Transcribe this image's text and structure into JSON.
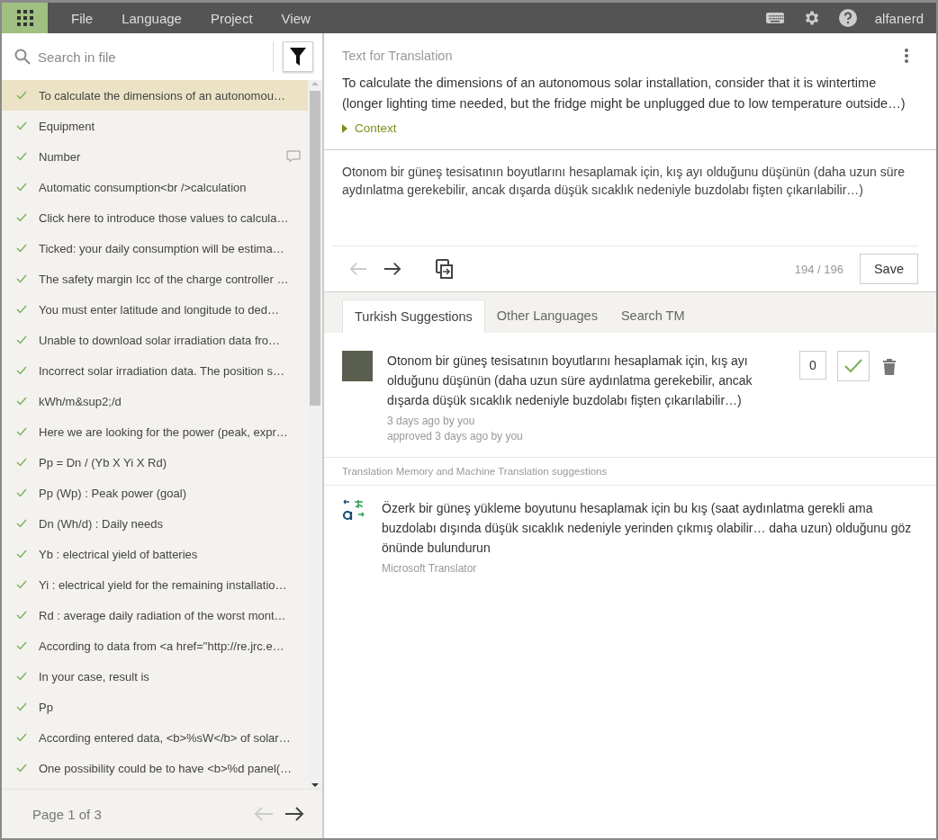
{
  "menu": {
    "items": [
      "File",
      "Language",
      "Project",
      "View"
    ],
    "user": "alfanerd"
  },
  "sidebar": {
    "search": {
      "placeholder": "Search in file"
    },
    "items": [
      {
        "text": "To calculate the dimensions of an autonomou…",
        "translated": true,
        "selected": true,
        "comment": false
      },
      {
        "text": "Equipment",
        "translated": true,
        "selected": false,
        "comment": false
      },
      {
        "text": "Number",
        "translated": true,
        "selected": false,
        "comment": true
      },
      {
        "text": "Automatic consumption<br />calculation",
        "translated": true,
        "selected": false,
        "comment": false
      },
      {
        "text": "Click here to introduce those values to calcula…",
        "translated": true,
        "selected": false,
        "comment": false
      },
      {
        "text": "Ticked: your daily consumption will be estima…",
        "translated": true,
        "selected": false,
        "comment": false
      },
      {
        "text": "The safety margin Icc of the charge controller …",
        "translated": true,
        "selected": false,
        "comment": false
      },
      {
        "text": "You must enter latitude and longitude to ded…",
        "translated": true,
        "selected": false,
        "comment": false
      },
      {
        "text": "Unable to download solar irradiation data fro…",
        "translated": true,
        "selected": false,
        "comment": false
      },
      {
        "text": "Incorrect solar irradiation data. The position s…",
        "translated": true,
        "selected": false,
        "comment": false
      },
      {
        "text": "kWh/m&sup2;/d",
        "translated": true,
        "selected": false,
        "comment": false
      },
      {
        "text": "Here we are looking for the power (peak, expr…",
        "translated": true,
        "selected": false,
        "comment": false
      },
      {
        "text": "Pp = Dn / (Yb X Yi X Rd)",
        "translated": true,
        "selected": false,
        "comment": false
      },
      {
        "text": "Pp (Wp) : Peak power (goal)",
        "translated": true,
        "selected": false,
        "comment": false
      },
      {
        "text": "Dn (Wh/d) : Daily needs",
        "translated": true,
        "selected": false,
        "comment": false
      },
      {
        "text": "Yb : electrical yield of batteries",
        "translated": true,
        "selected": false,
        "comment": false
      },
      {
        "text": "Yi : electrical yield for the remaining installatio…",
        "translated": true,
        "selected": false,
        "comment": false
      },
      {
        "text": "Rd : average daily radiation of the worst mont…",
        "translated": true,
        "selected": false,
        "comment": false
      },
      {
        "text": "According to data from <a href=\"http://re.jrc.e…",
        "translated": true,
        "selected": false,
        "comment": false
      },
      {
        "text": "In your case, result is",
        "translated": true,
        "selected": false,
        "comment": false
      },
      {
        "text": "Pp",
        "translated": true,
        "selected": false,
        "comment": false
      },
      {
        "text": "According entered data, <b>%sW</b> of solar…",
        "translated": true,
        "selected": false,
        "comment": false
      },
      {
        "text": "One possibility could be to have <b>%d panel(…",
        "translated": true,
        "selected": false,
        "comment": false
      }
    ],
    "pager": {
      "label": "Page 1 of 3",
      "prev_disabled": true,
      "next_disabled": false
    }
  },
  "editor": {
    "title": "Text for Translation",
    "source": "To calculate the dimensions of an autonomous solar installation, consider that it is wintertime (longer lighting time needed, but the fridge might be unplugged due to low temperature outside…)",
    "context": {
      "label": "Context",
      "expanded": false
    },
    "translation": "Otonom bir güneş tesisatının boyutlarını hesaplamak için, kış ayı olduğunu düşünün (daha uzun süre aydınlatma gerekebilir, ancak dışarda düşük sıcaklık nedeniyle buzdolabı fişten çıkarılabilir…)",
    "prev_disabled": true,
    "next_disabled": false,
    "counter": "194 / 196",
    "save": "Save"
  },
  "tabs": [
    {
      "label": "Turkish Suggestions",
      "selected": true
    },
    {
      "label": "Other Languages",
      "selected": false
    },
    {
      "label": "Search TM",
      "selected": false
    }
  ],
  "suggestion": {
    "text": "Otonom bir güneş tesisatının boyutlarını hesaplamak için, kış ayı olduğunu düşünün (daha uzun süre aydınlatma gerekebilir, ancak dışarda düşük sıcaklık nedeniyle buzdolabı fişten çıkarılabilir…)",
    "created": "3 days ago by you",
    "approved_note": "approved 3 days ago by you",
    "votes": "0",
    "approved": true
  },
  "machine_section": "Translation Memory and Machine Translation suggestions",
  "machine": [
    {
      "text": "Özerk bir güneş yükleme boyutunu hesaplamak için bu kış (saat aydınlatma gerekli ama buzdolabı dışında düşük sıcaklık nedeniyle yerinden çıkmış olabilir… daha uzun) olduğunu göz önünde bulundurun",
      "source": "Microsoft Translator"
    }
  ]
}
